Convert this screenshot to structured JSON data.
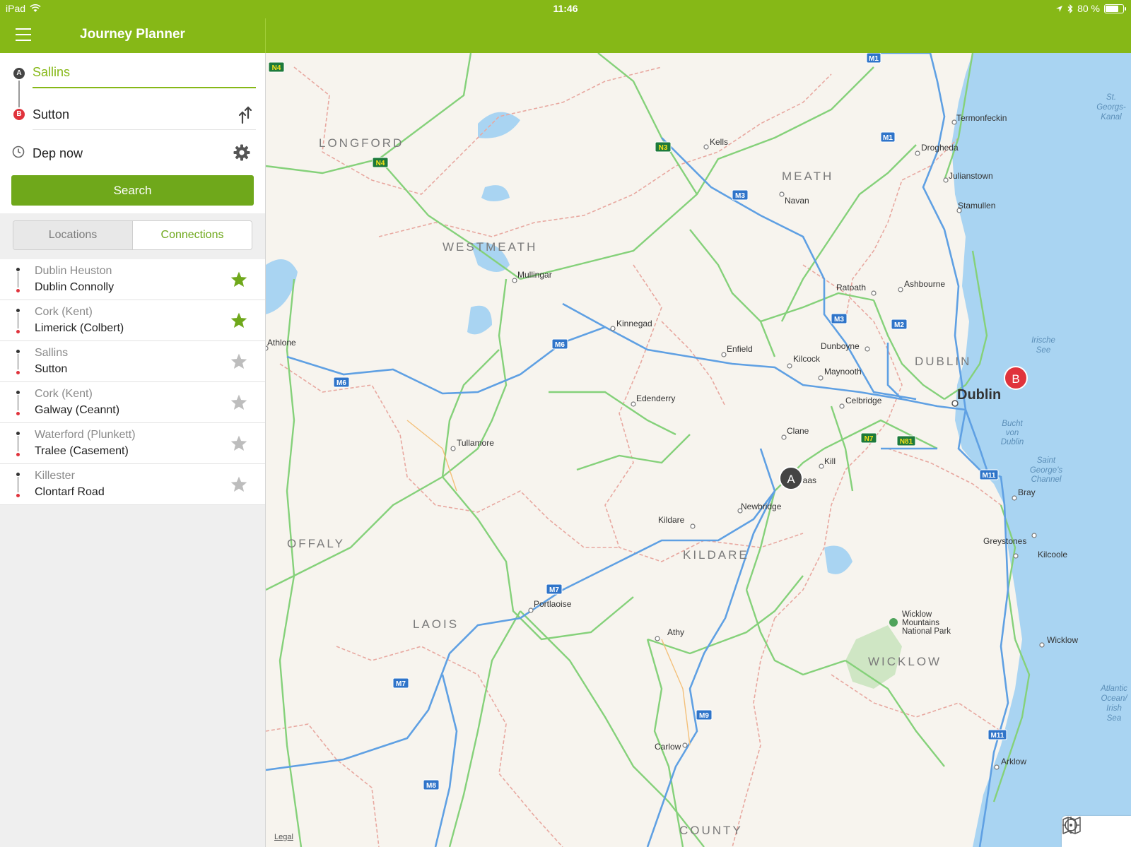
{
  "status_bar": {
    "device": "iPad",
    "time": "11:46",
    "battery": "80 %",
    "battery_level": 0.8
  },
  "header": {
    "title": "Journey Planner"
  },
  "form": {
    "from": "Sallins",
    "to": "Sutton",
    "time": "Dep now",
    "search_label": "Search",
    "pin_a": "A",
    "pin_b": "B"
  },
  "tabs": {
    "locations": "Locations",
    "connections": "Connections",
    "active": "connections"
  },
  "connections": [
    {
      "from": "Dublin Heuston",
      "to": "Dublin Connolly",
      "favorite": true
    },
    {
      "from": "Cork (Kent)",
      "to": "Limerick (Colbert)",
      "favorite": true
    },
    {
      "from": "Sallins",
      "to": "Sutton",
      "favorite": false
    },
    {
      "from": "Cork (Kent)",
      "to": "Galway (Ceannt)",
      "favorite": false
    },
    {
      "from": "Waterford (Plunkett)",
      "to": "Tralee (Casement)",
      "favorite": false
    },
    {
      "from": "Killester",
      "to": "Clontarf Road",
      "favorite": false
    }
  ],
  "colors": {
    "brand": "#86b817",
    "button": "#6fa81b",
    "pin_b": "#e0333c",
    "pin_a": "#444444",
    "star_on": "#6fa81b",
    "star_off": "#bdbdbd"
  },
  "map": {
    "legal": "Legal",
    "pin_a": "A",
    "pin_b": "B",
    "regions": [
      "LONGFORD",
      "MEATH",
      "WESTMEATH",
      "DUBLIN",
      "OFFALY",
      "KILDARE",
      "LAOIS",
      "WICKLOW",
      "COUNTY"
    ],
    "cities": {
      "dublin": "Dublin",
      "kells": "Kells",
      "drogheda": "Drogheda",
      "termonfeckin": "Termonfeckin",
      "julianstown": "Julianstown",
      "stamullen": "Stamullen",
      "navan": "Navan",
      "mullingar": "Mullingar",
      "ratoath": "Ratoath",
      "ashbourne": "Ashbourne",
      "kinnegad": "Kinnegad",
      "athlone": "Athlone",
      "enfield": "Enfield",
      "dunboyne": "Dunboyne",
      "kilcock": "Kilcock",
      "maynooth": "Maynooth",
      "celbridge": "Celbridge",
      "edenderry": "Edenderry",
      "clane": "Clane",
      "tullamore": "Tullamore",
      "kill": "Kill",
      "naas": "Naas",
      "newbridge": "Newbridge",
      "kildare": "Kildare",
      "bray": "Bray",
      "greystones": "Greystones",
      "kilcoole": "Kilcoole",
      "portlaoise": "Portlaoise",
      "athy": "Athy",
      "wicklow": "Wicklow",
      "carlow": "Carlow",
      "arklow": "Arklow"
    },
    "water": {
      "st_georgs": [
        "St.",
        "Georgs-",
        "Kanal"
      ],
      "irische_see": [
        "Irische",
        "See"
      ],
      "bucht": [
        "Bucht",
        "von",
        "Dublin"
      ],
      "saint_georges": [
        "Saint",
        "George's",
        "Channel"
      ],
      "atlantic": [
        "Atlantic",
        "Ocean/",
        "Irish",
        "Sea"
      ]
    },
    "park": [
      "Wicklow",
      "Mountains",
      "National Park"
    ],
    "shields": {
      "m1": "M1",
      "m2": "M2",
      "m3": "M3",
      "m6": "M6",
      "m7": "M7",
      "m8": "M8",
      "m9": "M9",
      "m11": "M11",
      "n3": "N3",
      "n4": "N4",
      "n7": "N7",
      "n81": "N81"
    }
  }
}
